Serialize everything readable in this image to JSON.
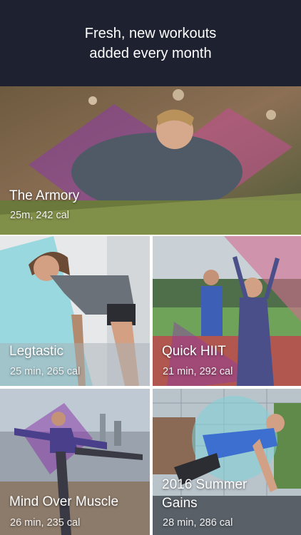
{
  "header": {
    "line1": "Fresh, new workouts",
    "line2": "added every month"
  },
  "workouts": [
    {
      "title": "The Armory",
      "meta": "25m, 242 cal"
    },
    {
      "title": "Legtastic",
      "meta": "25 min, 265 cal"
    },
    {
      "title": "Quick HIIT",
      "meta": "21 min, 292 cal"
    },
    {
      "title": "Mind Over Muscle",
      "meta": "26 min, 235 cal"
    },
    {
      "title_line1": "2016 Summer",
      "title_line2": "Gains",
      "meta": "28 min, 286 cal"
    }
  ],
  "colors": {
    "header_bg": "#1d2130",
    "accent_purple": "#8b3aa8",
    "accent_pink": "#c0508f",
    "accent_teal": "#7fd3d9"
  }
}
